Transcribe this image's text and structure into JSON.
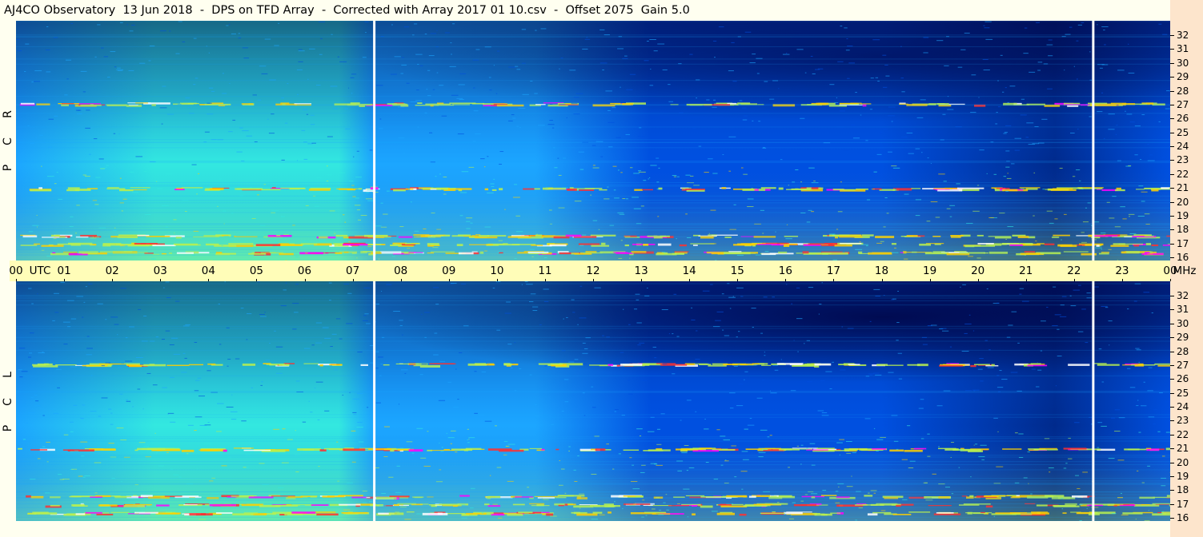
{
  "title": "AJ4CO Observatory  13 Jun 2018  -  DPS on TFD Array  -  Corrected with Array 2017 01 10.csv  -  Offset 2075  Gain 5.0",
  "chart_data": [
    {
      "type": "heatmap",
      "name": "RCP",
      "side_label": [
        "R",
        "C",
        "P"
      ],
      "x_axis": {
        "unit": "UTC",
        "range_hours": [
          0,
          24
        ]
      },
      "y_axis": {
        "unit": "MHz",
        "range": [
          16,
          32
        ]
      },
      "intensity_colormap": [
        "#00003c",
        "#002a8c",
        "#0050e0",
        "#1ca6ff",
        "#33e8e0",
        "#b8f050",
        "#ffd000",
        "#ff3030",
        "#ff00ff",
        "#ffffff"
      ],
      "data_gaps_utc": [
        7.45,
        22.4
      ],
      "interference_bands_mhz": [
        27.1,
        21.0,
        17.6,
        17.0,
        16.4
      ]
    },
    {
      "type": "heatmap",
      "name": "LCP",
      "side_label": [
        "L",
        "C",
        "P"
      ],
      "x_axis": {
        "unit": "UTC",
        "range_hours": [
          0,
          24
        ]
      },
      "y_axis": {
        "unit": "MHz",
        "range": [
          16,
          32
        ]
      },
      "intensity_colormap": [
        "#00003c",
        "#002a8c",
        "#0050e0",
        "#1ca6ff",
        "#33e8e0",
        "#b8f050",
        "#ffd000",
        "#ff3030",
        "#ff00ff",
        "#ffffff"
      ],
      "data_gaps_utc": [
        7.45,
        22.4
      ],
      "interference_bands_mhz": [
        27.1,
        21.0,
        17.6,
        17.0,
        16.4
      ]
    }
  ],
  "time_axis": {
    "labels": [
      "00",
      "UTC",
      "01",
      "02",
      "03",
      "04",
      "05",
      "06",
      "07",
      "08",
      "09",
      "10",
      "11",
      "12",
      "13",
      "14",
      "15",
      "16",
      "17",
      "18",
      "19",
      "20",
      "21",
      "22",
      "23",
      "00",
      "MHz"
    ]
  },
  "freq_axis": {
    "labels": [
      "32",
      "31",
      "30",
      "29",
      "28",
      "27",
      "26",
      "25",
      "24",
      "23",
      "22",
      "21",
      "20",
      "19",
      "18",
      "17",
      "16"
    ]
  }
}
